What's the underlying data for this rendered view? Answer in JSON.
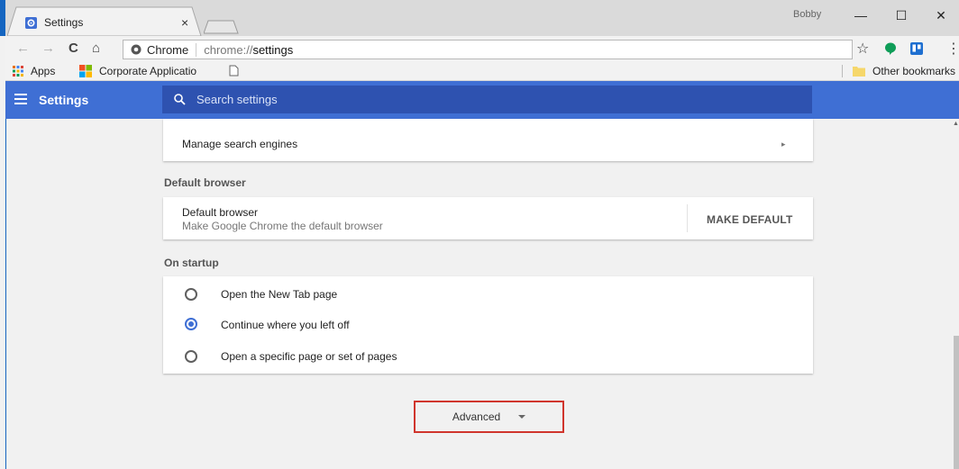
{
  "browser": {
    "tab_title": "Settings",
    "tab_close": "×",
    "profile_name": "Bobby",
    "window_controls": {
      "minimize": "—",
      "maximize": "☐",
      "close": "✕"
    },
    "nav": {
      "back": "←",
      "forward": "→",
      "reload": "C",
      "home": "⌂"
    },
    "omnibox": {
      "chip_label": "Chrome",
      "url_prefix": "chrome://",
      "url_path": "settings"
    },
    "star": "☆",
    "menu": "⋮"
  },
  "bookmarks": {
    "apps": "Apps",
    "corporate": "Corporate Applicatio",
    "other": "Other bookmarks"
  },
  "header": {
    "title": "Settings",
    "search_placeholder": "Search settings"
  },
  "search_engine": {
    "manage_label": "Manage search engines",
    "chevron": "▸"
  },
  "default_browser": {
    "section_title": "Default browser",
    "row_title": "Default browser",
    "row_subtitle": "Make Google Chrome the default browser",
    "button": "MAKE DEFAULT"
  },
  "on_startup": {
    "section_title": "On startup",
    "options": [
      {
        "label": "Open the New Tab page",
        "selected": false
      },
      {
        "label": "Continue where you left off",
        "selected": true
      },
      {
        "label": "Open a specific page or set of pages",
        "selected": false
      }
    ]
  },
  "advanced": {
    "label": "Advanced"
  },
  "colors": {
    "accent": "#3f6fd4",
    "highlight_box": "#d0352d"
  }
}
